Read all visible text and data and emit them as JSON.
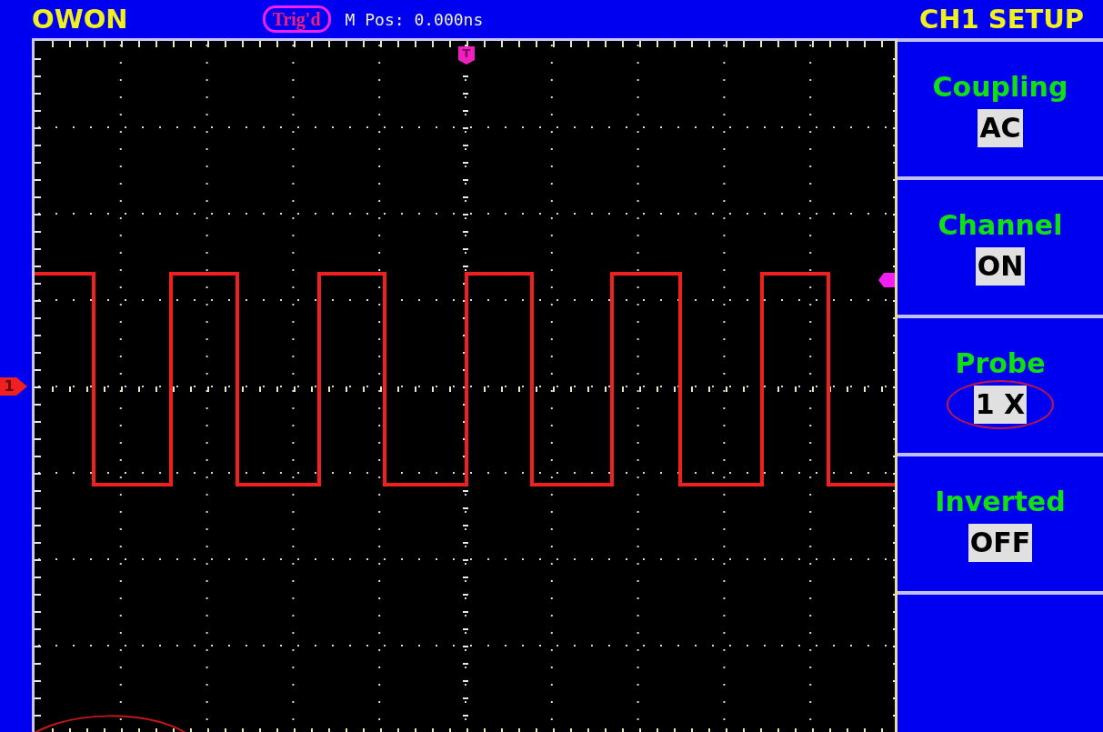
{
  "header": {
    "brand": "OWON",
    "trigger_status": "Trig'd",
    "position": "M Pos: 0.000ns",
    "menu_title": "CH1 SETUP"
  },
  "screen": {
    "trigger_marker": "T",
    "channel_marker": "1"
  },
  "menu": [
    {
      "label": "Coupling",
      "value": "AC",
      "circled": false
    },
    {
      "label": "Channel",
      "value": "ON",
      "circled": false
    },
    {
      "label": "Probe",
      "value": "1 X",
      "circled": true
    },
    {
      "label": "Inverted",
      "value": "OFF",
      "circled": false
    }
  ]
}
